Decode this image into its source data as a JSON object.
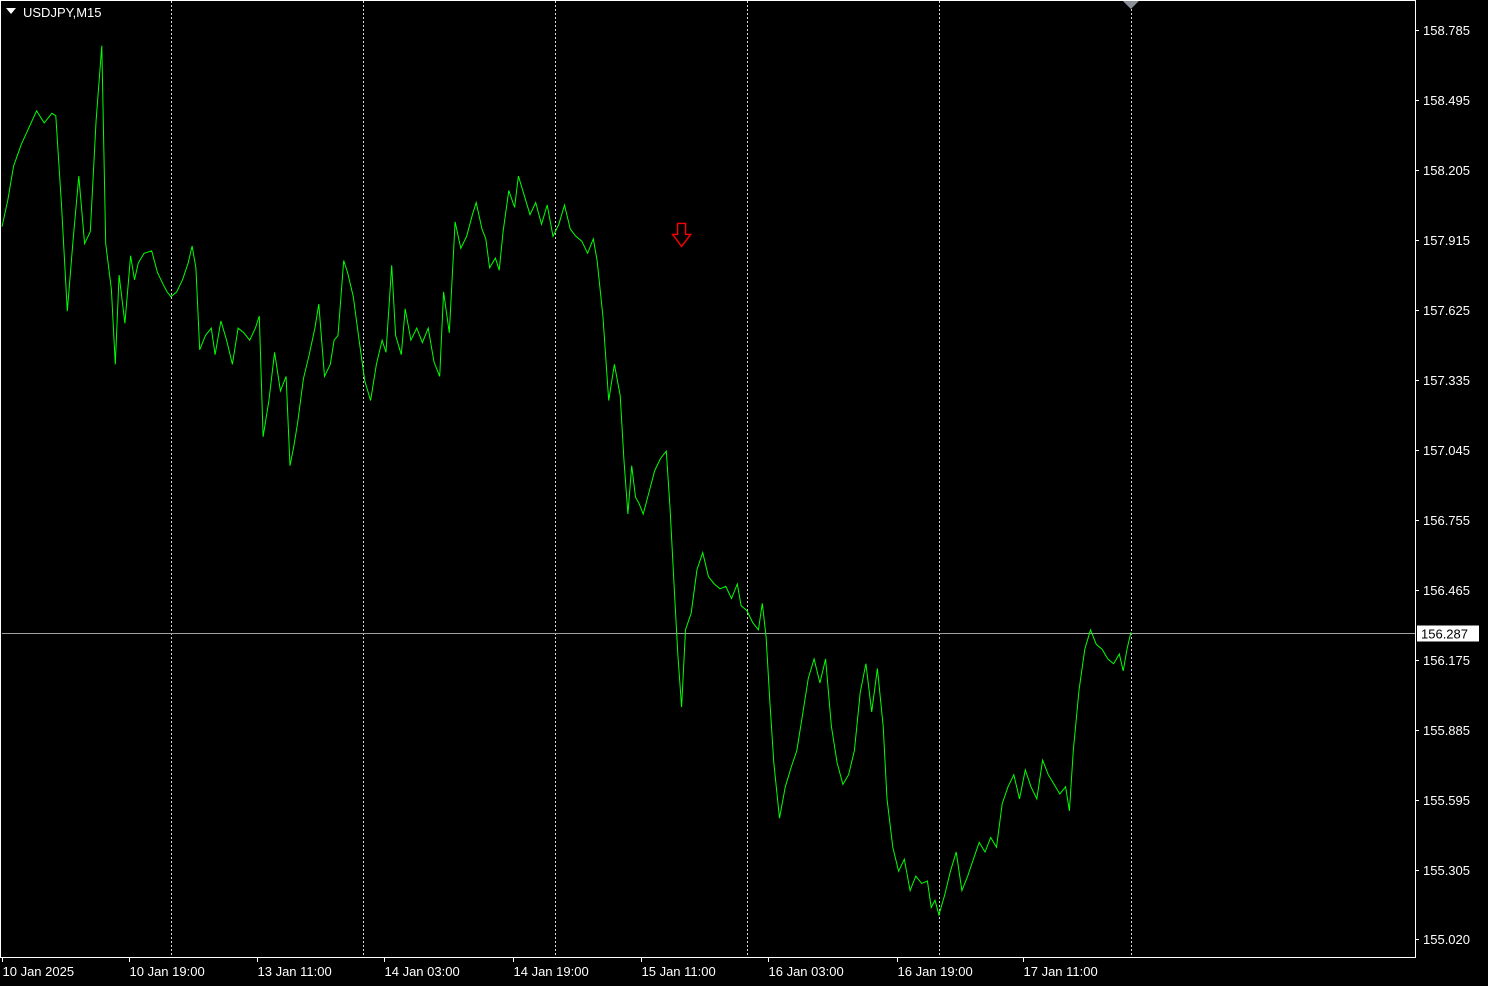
{
  "symbol_label": "USDJPY,M15",
  "current_price_label": "156.287",
  "colors": {
    "background": "#000000",
    "price_line": "#00ff00",
    "grid": "#ffffff",
    "axis": "#ffffff",
    "current_price_line": "#a0a0a0",
    "signal_arrow": "#ff0000",
    "shift_marker": "#8a8f96"
  },
  "signal_arrow": {
    "icon": "red-down-arrow-icon",
    "time_index": 354,
    "price": 157.93
  },
  "chart_data": {
    "type": "line",
    "title": "USDJPY,M15",
    "xlabel": "",
    "ylabel": "",
    "grid": true,
    "ylim": [
      154.945,
      158.905
    ],
    "x_range": [
      0,
      736
    ],
    "y_ticks": [
      "158.785",
      "158.495",
      "158.205",
      "157.915",
      "157.625",
      "157.335",
      "157.045",
      "156.755",
      "156.465",
      "156.175",
      "155.885",
      "155.595",
      "155.305",
      "155.020"
    ],
    "x_ticks": [
      {
        "label": "10 Jan 2025",
        "index": 0
      },
      {
        "label": "10 Jan 19:00",
        "index": 66
      },
      {
        "label": "13 Jan 11:00",
        "index": 133
      },
      {
        "label": "14 Jan 03:00",
        "index": 199
      },
      {
        "label": "14 Jan 19:00",
        "index": 266
      },
      {
        "label": "15 Jan 11:00",
        "index": 333
      },
      {
        "label": "16 Jan 03:00",
        "index": 399
      },
      {
        "label": "16 Jan 19:00",
        "index": 466
      },
      {
        "label": "17 Jan 11:00",
        "index": 532
      }
    ],
    "vertical_grid_indices": [
      88,
      188,
      288,
      388,
      488,
      588
    ],
    "current_price": 156.287,
    "series": [
      {
        "points": [
          [
            0,
            157.97
          ],
          [
            3,
            158.08
          ],
          [
            6,
            158.22
          ],
          [
            10,
            158.31
          ],
          [
            14,
            158.38
          ],
          [
            18,
            158.45
          ],
          [
            22,
            158.4
          ],
          [
            26,
            158.44
          ],
          [
            28,
            158.43
          ],
          [
            31,
            158.06
          ],
          [
            34,
            157.62
          ],
          [
            37,
            157.91
          ],
          [
            40,
            158.18
          ],
          [
            43,
            157.9
          ],
          [
            46,
            157.95
          ],
          [
            49,
            158.41
          ],
          [
            52,
            158.72
          ],
          [
            54,
            157.9
          ],
          [
            57,
            157.71
          ],
          [
            59,
            157.4
          ],
          [
            61,
            157.77
          ],
          [
            64,
            157.57
          ],
          [
            67,
            157.85
          ],
          [
            69,
            157.75
          ],
          [
            71,
            157.82
          ],
          [
            74,
            157.86
          ],
          [
            78,
            157.87
          ],
          [
            81,
            157.78
          ],
          [
            84,
            157.73
          ],
          [
            86,
            157.7
          ],
          [
            88,
            157.68
          ],
          [
            91,
            157.7
          ],
          [
            94,
            157.75
          ],
          [
            97,
            157.82
          ],
          [
            99,
            157.89
          ],
          [
            101,
            157.8
          ],
          [
            103,
            157.46
          ],
          [
            106,
            157.52
          ],
          [
            109,
            157.55
          ],
          [
            111,
            157.44
          ],
          [
            114,
            157.58
          ],
          [
            117,
            157.5
          ],
          [
            120,
            157.4
          ],
          [
            123,
            157.55
          ],
          [
            126,
            157.53
          ],
          [
            129,
            157.5
          ],
          [
            132,
            157.55
          ],
          [
            134,
            157.6
          ],
          [
            136,
            157.1
          ],
          [
            139,
            157.25
          ],
          [
            142,
            157.45
          ],
          [
            145,
            157.29
          ],
          [
            148,
            157.35
          ],
          [
            150,
            156.98
          ],
          [
            152,
            157.06
          ],
          [
            154,
            157.16
          ],
          [
            157,
            157.34
          ],
          [
            160,
            157.44
          ],
          [
            163,
            157.55
          ],
          [
            165,
            157.65
          ],
          [
            168,
            157.35
          ],
          [
            171,
            157.4
          ],
          [
            173,
            157.5
          ],
          [
            175,
            157.52
          ],
          [
            178,
            157.83
          ],
          [
            180,
            157.78
          ],
          [
            183,
            157.68
          ],
          [
            186,
            157.5
          ],
          [
            189,
            157.33
          ],
          [
            192,
            157.25
          ],
          [
            195,
            157.4
          ],
          [
            198,
            157.5
          ],
          [
            200,
            157.45
          ],
          [
            203,
            157.81
          ],
          [
            205,
            157.52
          ],
          [
            208,
            157.44
          ],
          [
            210,
            157.63
          ],
          [
            213,
            157.5
          ],
          [
            216,
            157.55
          ],
          [
            219,
            157.49
          ],
          [
            222,
            157.55
          ],
          [
            225,
            157.41
          ],
          [
            228,
            157.35
          ],
          [
            230,
            157.7
          ],
          [
            233,
            157.53
          ],
          [
            236,
            157.99
          ],
          [
            239,
            157.88
          ],
          [
            242,
            157.93
          ],
          [
            245,
            158.02
          ],
          [
            247,
            158.07
          ],
          [
            250,
            157.96
          ],
          [
            252,
            157.92
          ],
          [
            254,
            157.8
          ],
          [
            257,
            157.84
          ],
          [
            259,
            157.79
          ],
          [
            261,
            157.95
          ],
          [
            264,
            158.12
          ],
          [
            267,
            158.05
          ],
          [
            269,
            158.18
          ],
          [
            272,
            158.1
          ],
          [
            275,
            158.02
          ],
          [
            278,
            158.07
          ],
          [
            281,
            157.98
          ],
          [
            284,
            158.06
          ],
          [
            287,
            157.93
          ],
          [
            290,
            157.98
          ],
          [
            293,
            158.06
          ],
          [
            296,
            157.96
          ],
          [
            299,
            157.93
          ],
          [
            302,
            157.91
          ],
          [
            305,
            157.86
          ],
          [
            308,
            157.92
          ],
          [
            310,
            157.83
          ],
          [
            313,
            157.6
          ],
          [
            316,
            157.25
          ],
          [
            319,
            157.4
          ],
          [
            322,
            157.27
          ],
          [
            324,
            157.0
          ],
          [
            326,
            156.78
          ],
          [
            328,
            156.98
          ],
          [
            330,
            156.85
          ],
          [
            332,
            156.82
          ],
          [
            334,
            156.78
          ],
          [
            337,
            156.87
          ],
          [
            340,
            156.96
          ],
          [
            343,
            157.01
          ],
          [
            346,
            157.04
          ],
          [
            348,
            156.8
          ],
          [
            350,
            156.5
          ],
          [
            352,
            156.2
          ],
          [
            354,
            155.98
          ],
          [
            356,
            156.3
          ],
          [
            359,
            156.37
          ],
          [
            362,
            156.55
          ],
          [
            365,
            156.62
          ],
          [
            368,
            156.52
          ],
          [
            371,
            156.49
          ],
          [
            374,
            156.47
          ],
          [
            377,
            156.48
          ],
          [
            380,
            156.43
          ],
          [
            383,
            156.49
          ],
          [
            385,
            156.4
          ],
          [
            388,
            156.38
          ],
          [
            391,
            156.33
          ],
          [
            394,
            156.3
          ],
          [
            396,
            156.41
          ],
          [
            398,
            156.27
          ],
          [
            400,
            156.0
          ],
          [
            402,
            155.75
          ],
          [
            405,
            155.52
          ],
          [
            408,
            155.65
          ],
          [
            411,
            155.73
          ],
          [
            414,
            155.8
          ],
          [
            417,
            155.95
          ],
          [
            420,
            156.1
          ],
          [
            423,
            156.18
          ],
          [
            426,
            156.08
          ],
          [
            429,
            156.18
          ],
          [
            432,
            155.9
          ],
          [
            435,
            155.75
          ],
          [
            438,
            155.66
          ],
          [
            441,
            155.7
          ],
          [
            444,
            155.8
          ],
          [
            447,
            156.04
          ],
          [
            450,
            156.16
          ],
          [
            453,
            155.96
          ],
          [
            456,
            156.14
          ],
          [
            459,
            155.9
          ],
          [
            461,
            155.6
          ],
          [
            464,
            155.4
          ],
          [
            467,
            155.3
          ],
          [
            470,
            155.35
          ],
          [
            473,
            155.22
          ],
          [
            476,
            155.28
          ],
          [
            479,
            155.25
          ],
          [
            482,
            155.26
          ],
          [
            484,
            155.15
          ],
          [
            486,
            155.18
          ],
          [
            488,
            155.12
          ],
          [
            491,
            155.2
          ],
          [
            494,
            155.3
          ],
          [
            497,
            155.38
          ],
          [
            500,
            155.22
          ],
          [
            503,
            155.28
          ],
          [
            506,
            155.35
          ],
          [
            509,
            155.42
          ],
          [
            512,
            155.38
          ],
          [
            515,
            155.44
          ],
          [
            518,
            155.4
          ],
          [
            521,
            155.58
          ],
          [
            524,
            155.65
          ],
          [
            527,
            155.7
          ],
          [
            530,
            155.6
          ],
          [
            533,
            155.72
          ],
          [
            536,
            155.65
          ],
          [
            539,
            155.6
          ],
          [
            542,
            155.76
          ],
          [
            545,
            155.7
          ],
          [
            548,
            155.66
          ],
          [
            551,
            155.62
          ],
          [
            554,
            155.65
          ],
          [
            556,
            155.55
          ],
          [
            558,
            155.8
          ],
          [
            561,
            156.05
          ],
          [
            564,
            156.22
          ],
          [
            567,
            156.3
          ],
          [
            570,
            156.24
          ],
          [
            573,
            156.22
          ],
          [
            576,
            156.18
          ],
          [
            579,
            156.16
          ],
          [
            582,
            156.2
          ],
          [
            584,
            156.13
          ],
          [
            586,
            156.22
          ],
          [
            588,
            156.29
          ]
        ]
      }
    ]
  }
}
